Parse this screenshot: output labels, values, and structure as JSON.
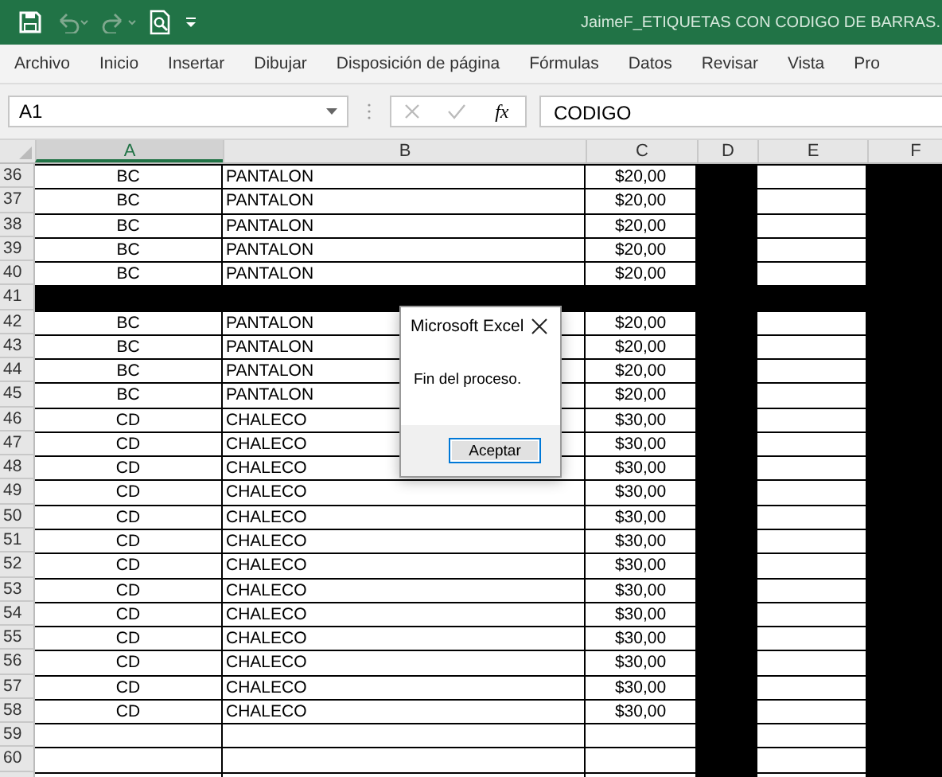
{
  "window": {
    "title": "JaimeF_ETIQUETAS CON CODIGO DE BARRAS."
  },
  "menu": [
    {
      "label": "Archivo"
    },
    {
      "label": "Inicio"
    },
    {
      "label": "Insertar"
    },
    {
      "label": "Dibujar"
    },
    {
      "label": "Disposición de página"
    },
    {
      "label": "Fórmulas"
    },
    {
      "label": "Datos"
    },
    {
      "label": "Revisar"
    },
    {
      "label": "Vista"
    },
    {
      "label": "Pro"
    }
  ],
  "formula_bar": {
    "name_box": "A1",
    "function_label": "fx",
    "value": "CODIGO"
  },
  "columns": [
    {
      "label": "A",
      "selected": true,
      "blacked": false
    },
    {
      "label": "B",
      "selected": false,
      "blacked": false
    },
    {
      "label": "C",
      "selected": false,
      "blacked": false
    },
    {
      "label": "D",
      "selected": false,
      "blacked": true
    },
    {
      "label": "E",
      "selected": false,
      "blacked": false
    },
    {
      "label": "F",
      "selected": false,
      "blacked": true
    }
  ],
  "rows": [
    {
      "num": "36",
      "blacked": false,
      "cells": [
        "BC",
        "PANTALON",
        "$20,00"
      ]
    },
    {
      "num": "37",
      "blacked": false,
      "cells": [
        "BC",
        "PANTALON",
        "$20,00"
      ]
    },
    {
      "num": "38",
      "blacked": false,
      "cells": [
        "BC",
        "PANTALON",
        "$20,00"
      ]
    },
    {
      "num": "39",
      "blacked": false,
      "cells": [
        "BC",
        "PANTALON",
        "$20,00"
      ]
    },
    {
      "num": "40",
      "blacked": false,
      "cells": [
        "BC",
        "PANTALON",
        "$20,00"
      ]
    },
    {
      "num": "41",
      "blacked": true,
      "cells": []
    },
    {
      "num": "42",
      "blacked": false,
      "cells": [
        "BC",
        "PANTALON",
        "$20,00"
      ]
    },
    {
      "num": "43",
      "blacked": false,
      "cells": [
        "BC",
        "PANTALON",
        "$20,00"
      ]
    },
    {
      "num": "44",
      "blacked": false,
      "cells": [
        "BC",
        "PANTALON",
        "$20,00"
      ]
    },
    {
      "num": "45",
      "blacked": false,
      "cells": [
        "BC",
        "PANTALON",
        "$20,00"
      ]
    },
    {
      "num": "46",
      "blacked": false,
      "cells": [
        "CD",
        "CHALECO",
        "$30,00"
      ]
    },
    {
      "num": "47",
      "blacked": false,
      "cells": [
        "CD",
        "CHALECO",
        "$30,00"
      ]
    },
    {
      "num": "48",
      "blacked": false,
      "cells": [
        "CD",
        "CHALECO",
        "$30,00"
      ]
    },
    {
      "num": "49",
      "blacked": false,
      "cells": [
        "CD",
        "CHALECO",
        "$30,00"
      ]
    },
    {
      "num": "50",
      "blacked": false,
      "cells": [
        "CD",
        "CHALECO",
        "$30,00"
      ]
    },
    {
      "num": "51",
      "blacked": false,
      "cells": [
        "CD",
        "CHALECO",
        "$30,00"
      ]
    },
    {
      "num": "52",
      "blacked": false,
      "cells": [
        "CD",
        "CHALECO",
        "$30,00"
      ]
    },
    {
      "num": "53",
      "blacked": false,
      "cells": [
        "CD",
        "CHALECO",
        "$30,00"
      ]
    },
    {
      "num": "54",
      "blacked": false,
      "cells": [
        "CD",
        "CHALECO",
        "$30,00"
      ]
    },
    {
      "num": "55",
      "blacked": false,
      "cells": [
        "CD",
        "CHALECO",
        "$30,00"
      ]
    },
    {
      "num": "56",
      "blacked": false,
      "cells": [
        "CD",
        "CHALECO",
        "$30,00"
      ]
    },
    {
      "num": "57",
      "blacked": false,
      "cells": [
        "CD",
        "CHALECO",
        "$30,00"
      ]
    },
    {
      "num": "58",
      "blacked": false,
      "cells": [
        "CD",
        "CHALECO",
        "$30,00"
      ]
    },
    {
      "num": "59",
      "blacked": false,
      "cells": []
    },
    {
      "num": "60",
      "blacked": false,
      "cells": []
    }
  ],
  "dialog": {
    "title": "Microsoft Excel",
    "message": "Fin del proceso.",
    "button": "Aceptar"
  }
}
